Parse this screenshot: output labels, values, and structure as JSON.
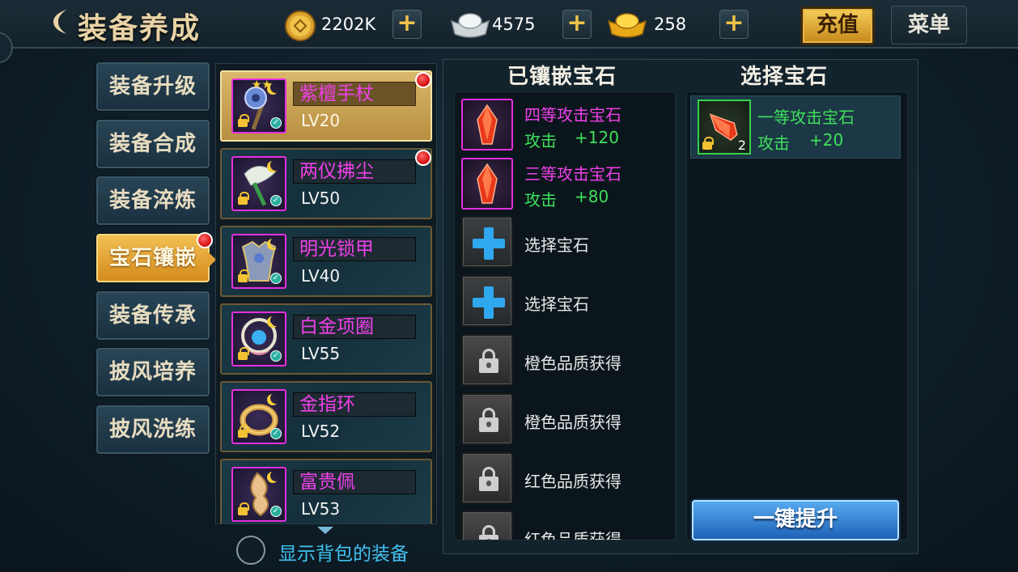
{
  "header": {
    "title": "装备养成",
    "currencies": [
      {
        "name": "copper-coin",
        "value": "2202K"
      },
      {
        "name": "silver-ingot",
        "value": "4575"
      },
      {
        "name": "gold-ingot",
        "value": "258"
      }
    ],
    "plus_label": "+",
    "recharge_label": "充值",
    "menu_label": "菜单"
  },
  "tabs": [
    {
      "label": "装备升级",
      "active": false
    },
    {
      "label": "装备合成",
      "active": false
    },
    {
      "label": "装备淬炼",
      "active": false
    },
    {
      "label": "宝石镶嵌",
      "active": true,
      "badge": true
    },
    {
      "label": "装备传承",
      "active": false
    },
    {
      "label": "披风培养",
      "active": false
    },
    {
      "label": "披风洗练",
      "active": false
    }
  ],
  "equipment": [
    {
      "name": "紫檀手杖",
      "level": "LV20",
      "icon": "staff-icon",
      "selected": true,
      "badge": true,
      "stars": "★★"
    },
    {
      "name": "两仪拂尘",
      "level": "LV50",
      "icon": "whisk-icon",
      "selected": false,
      "badge": true
    },
    {
      "name": "明光锁甲",
      "level": "LV40",
      "icon": "armor-icon",
      "selected": false,
      "badge": false
    },
    {
      "name": "白金项圈",
      "level": "LV55",
      "icon": "necklace-icon",
      "selected": false,
      "badge": false
    },
    {
      "name": "金指环",
      "level": "LV52",
      "icon": "ring-icon",
      "selected": false,
      "badge": false
    },
    {
      "name": "富贵佩",
      "level": "LV53",
      "icon": "pendant-icon",
      "selected": false,
      "badge": false
    }
  ],
  "show_bag_label": "显示背包的装备",
  "inlaid": {
    "title": "已镶嵌宝石",
    "slots": [
      {
        "type": "gem",
        "name": "四等攻击宝石",
        "stat_label": "攻击",
        "stat_value": "+120"
      },
      {
        "type": "gem",
        "name": "三等攻击宝石",
        "stat_label": "攻击",
        "stat_value": "+80"
      },
      {
        "type": "empty",
        "text": "选择宝石"
      },
      {
        "type": "empty",
        "text": "选择宝石"
      },
      {
        "type": "locked",
        "text": "橙色品质获得"
      },
      {
        "type": "locked",
        "text": "橙色品质获得"
      },
      {
        "type": "locked",
        "text": "红色品质获得"
      },
      {
        "type": "locked",
        "text": "红色品质获得"
      }
    ]
  },
  "select": {
    "title": "选择宝石",
    "candidates": [
      {
        "name": "一等攻击宝石",
        "count": "2",
        "stat_label": "攻击",
        "stat_value": "+20"
      }
    ],
    "upgrade_label": "一键提升"
  },
  "colors": {
    "accent_gold": "#f3c053",
    "gem_magenta": "#f040ea",
    "stat_green": "#3ee05a",
    "link_blue": "#41c3f2"
  }
}
